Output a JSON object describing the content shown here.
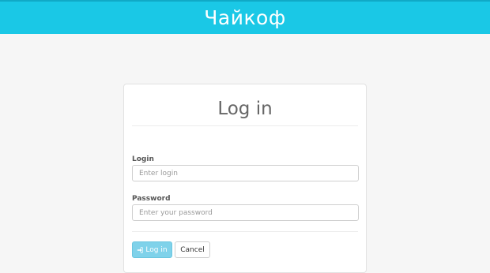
{
  "header": {
    "brand": "Чайкоф",
    "color": "#1ac8e6"
  },
  "login_panel": {
    "title": "Log in",
    "login_label": "Login",
    "login_placeholder": "Enter login",
    "login_value": "",
    "password_label": "Password",
    "password_placeholder": "Enter your password",
    "password_value": "",
    "submit_label": "Log in",
    "submit_icon": "sign-in-icon",
    "cancel_label": "Cancel"
  }
}
